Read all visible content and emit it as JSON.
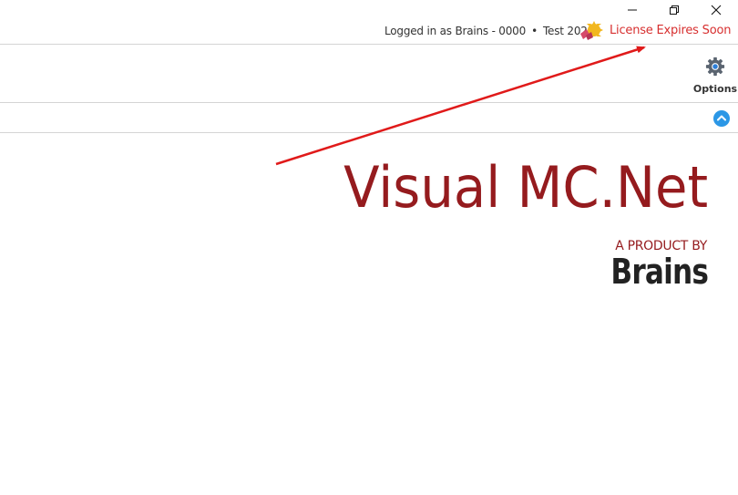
{
  "window": {
    "controls": {
      "minimize_icon": "minimize-icon",
      "maximize_icon": "restore-icon",
      "close_icon": "close-icon"
    }
  },
  "header": {
    "login_text": "Logged in as Brains - 0000",
    "separator": "•",
    "company": "Test 2023",
    "license_icon": "license-warning-icon",
    "license_text": "License Expires Soon",
    "license_color": "#d72f2f"
  },
  "ribbon": {
    "options_label": "Options",
    "options_icon": "gear-icon"
  },
  "collapse": {
    "icon": "chevron-up-icon",
    "color": "#2b97e6"
  },
  "branding": {
    "product_name": "Visual MC.Net",
    "tagline": "A PRODUCT BY",
    "company": "Brains",
    "accent_color": "#951b1e"
  },
  "annotation": {
    "arrow_color": "#e01a1a"
  }
}
